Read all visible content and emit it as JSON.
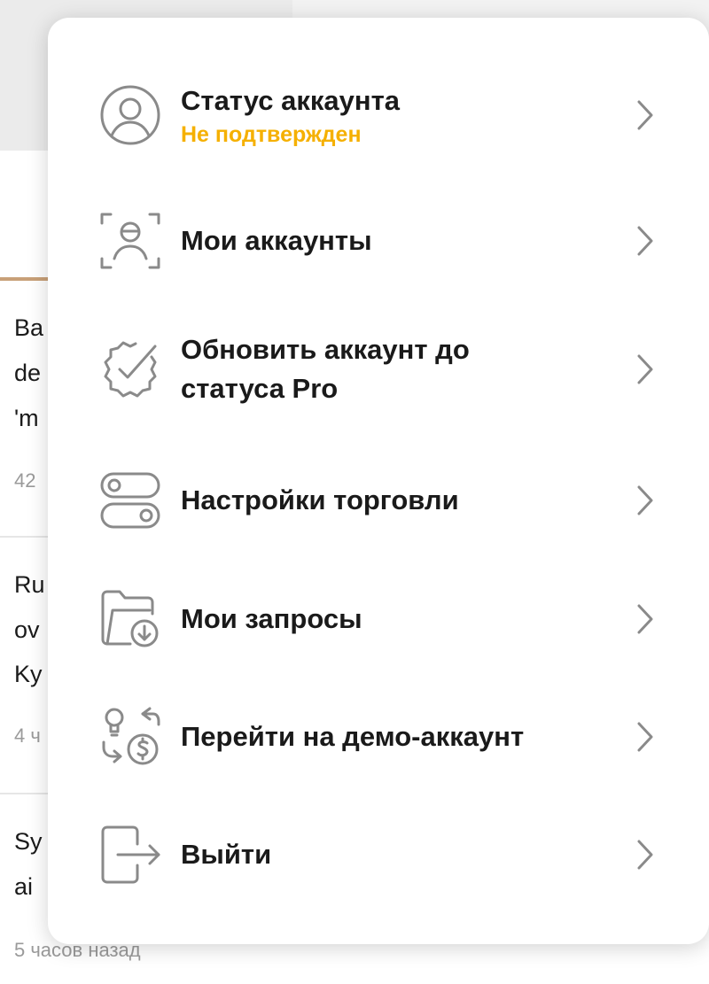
{
  "background": {
    "articles": [
      {
        "lines": [
          "Ba",
          "de",
          "'m"
        ],
        "meta": "42"
      },
      {
        "lines": [
          "Ru",
          "ov",
          "Ky"
        ],
        "meta": "4 ч"
      },
      {
        "lines": [
          "Sy",
          "ai"
        ],
        "meta": "5 часов назад"
      }
    ]
  },
  "menu": {
    "items": [
      {
        "label": "Статус аккаунта",
        "sublabel": "Не подтвержден",
        "icon": "user-circle-icon"
      },
      {
        "label": "Мои аккаунты",
        "icon": "face-scan-icon"
      },
      {
        "label": "Обновить аккаунт до статуса Pro",
        "icon": "badge-check-icon"
      },
      {
        "label": "Настройки торговли",
        "icon": "toggles-icon"
      },
      {
        "label": "Мои запросы",
        "icon": "folder-download-icon"
      },
      {
        "label": "Перейти на демо-аккаунт",
        "icon": "switch-demo-icon"
      },
      {
        "label": "Выйти",
        "icon": "logout-icon"
      }
    ],
    "colors": {
      "status_warning": "#F5B000",
      "icon": "#8A8A8A",
      "text": "#1A1A1A"
    }
  }
}
